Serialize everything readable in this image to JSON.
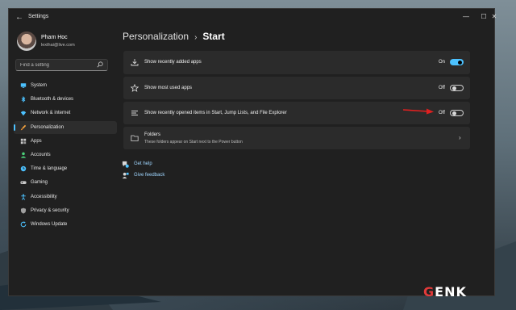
{
  "window": {
    "title": "Settings",
    "controls": [
      "minimize",
      "maximize",
      "close"
    ]
  },
  "user": {
    "name": "Pham Hoc",
    "email": "lexthai@live.com"
  },
  "search": {
    "placeholder": "Find a setting",
    "value": ""
  },
  "sidebar": {
    "items": [
      {
        "label": "System",
        "icon": "monitor-icon",
        "color": "#4cc2ff"
      },
      {
        "label": "Bluetooth & devices",
        "icon": "bluetooth-icon",
        "color": "#4cc2ff"
      },
      {
        "label": "Network & internet",
        "icon": "wifi-icon",
        "color": "#4cc2ff"
      },
      {
        "label": "Personalization",
        "icon": "brush-icon",
        "color": "#f7a541",
        "active": true
      },
      {
        "label": "Apps",
        "icon": "apps-icon",
        "color": "#c9c9c9"
      },
      {
        "label": "Accounts",
        "icon": "person-icon",
        "color": "#4cd37b"
      },
      {
        "label": "Time & language",
        "icon": "globe-clock-icon",
        "color": "#4cc2ff"
      },
      {
        "label": "Gaming",
        "icon": "gamepad-icon",
        "color": "#c9c9c9"
      },
      {
        "label": "Accessibility",
        "icon": "accessibility-icon",
        "color": "#4cc2ff"
      },
      {
        "label": "Privacy & security",
        "icon": "shield-icon",
        "color": "#a0a0a0"
      },
      {
        "label": "Windows Update",
        "icon": "update-icon",
        "color": "#4cc2ff"
      }
    ]
  },
  "breadcrumb": {
    "parent": "Personalization",
    "separator": "›",
    "current": "Start"
  },
  "settings": [
    {
      "label": "Show recently added apps",
      "icon": "download-icon",
      "state_text": "On",
      "on": true
    },
    {
      "label": "Show most used apps",
      "icon": "star-icon",
      "state_text": "Off",
      "on": false
    },
    {
      "label": "Show recently opened items in Start, Jump Lists, and File Explorer",
      "icon": "list-icon",
      "state_text": "Off",
      "on": false
    },
    {
      "label": "Folders",
      "sublabel": "These folders appear on Start next to the Power button",
      "icon": "folder-icon"
    }
  ],
  "links": {
    "help": "Get help",
    "feedback": "Give feedback"
  },
  "watermark": "GENK",
  "colors": {
    "accent": "#4cc2ff",
    "window_bg": "#202020",
    "card_bg": "#2b2b2b",
    "annotation_arrow": "#e02020"
  }
}
